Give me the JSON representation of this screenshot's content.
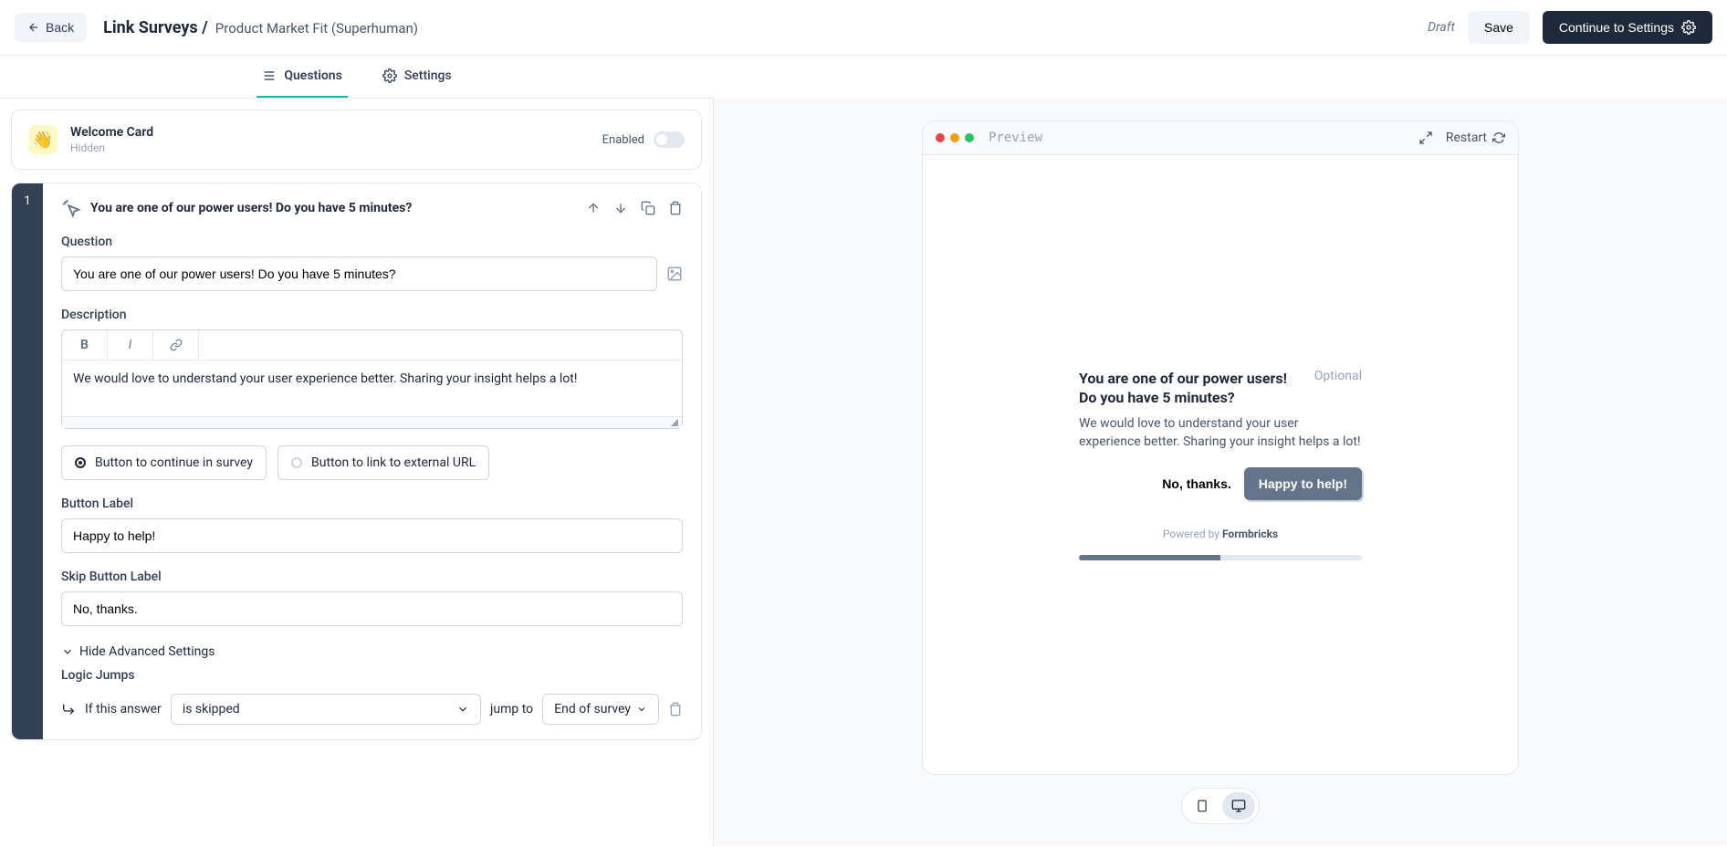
{
  "header": {
    "back": "Back",
    "breadcrumb_root": "Link Surveys /",
    "breadcrumb_page": "Product Market Fit (Superhuman)",
    "status": "Draft",
    "save": "Save",
    "continue": "Continue to Settings"
  },
  "tabs": {
    "questions": "Questions",
    "settings": "Settings"
  },
  "welcome": {
    "title": "Welcome Card",
    "subtitle": "Hidden",
    "enabled_label": "Enabled"
  },
  "question": {
    "number": "1",
    "title": "You are one of our power users! Do you have 5 minutes?",
    "question_label": "Question",
    "question_value": "You are one of our power users! Do you have 5 minutes?",
    "description_label": "Description",
    "description_value": "We would love to understand your user experience better. Sharing your insight helps a lot!",
    "radio_continue": "Button to continue in survey",
    "radio_external": "Button to link to external URL",
    "button_label_label": "Button Label",
    "button_label_value": "Happy to help!",
    "skip_label_label": "Skip Button Label",
    "skip_label_value": "No, thanks.",
    "hide_advanced": "Hide Advanced Settings",
    "logic_jumps_label": "Logic Jumps",
    "logic_prefix": "If this answer",
    "logic_condition": "is skipped",
    "logic_jump_to": "jump to",
    "logic_target": "End of survey"
  },
  "preview": {
    "label": "Preview",
    "restart": "Restart",
    "q_title": "You are one of our power users! Do you have 5 minutes?",
    "optional": "Optional",
    "description": "We would love to understand your user experience better. Sharing your insight helps a lot!",
    "secondary_btn": "No, thanks.",
    "primary_btn": "Happy to help!",
    "powered_prefix": "Powered by ",
    "powered_brand": "Formbricks"
  }
}
